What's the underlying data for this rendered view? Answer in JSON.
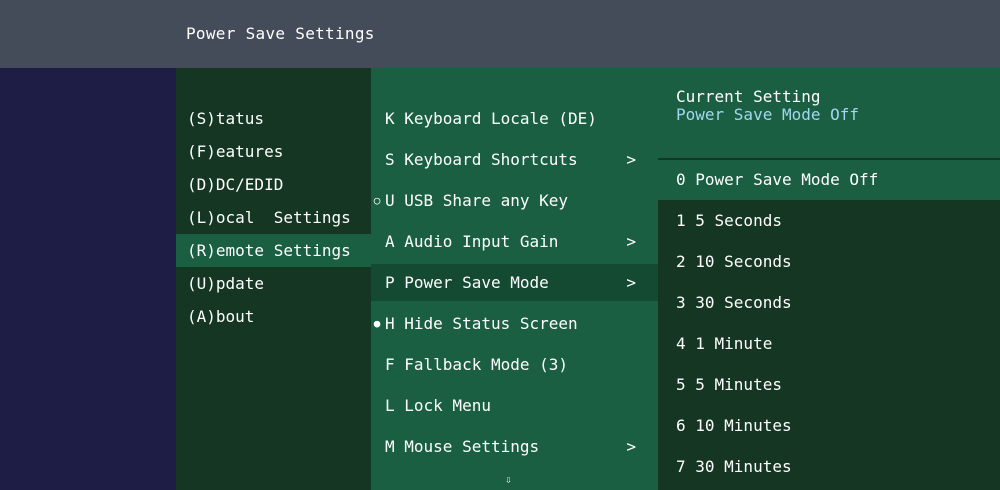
{
  "title": "Power Save Settings",
  "colors": {
    "title_bar": "#444c5a",
    "left_strip": "#1e1d46",
    "dark_green": "#143623",
    "mid_green": "#1a5f42",
    "current_value_text": "#9fd8ee"
  },
  "main_menu": [
    {
      "label": "(S)tatus",
      "selected": false
    },
    {
      "label": "(F)eatures",
      "selected": false
    },
    {
      "label": "(D)DC/EDID",
      "selected": false
    },
    {
      "label": "(L)ocal  Settings",
      "selected": false
    },
    {
      "label": "(R)emote Settings",
      "selected": true
    },
    {
      "label": "(U)pdate",
      "selected": false
    },
    {
      "label": "(A)bout",
      "selected": false
    }
  ],
  "sub_menu": [
    {
      "label": "K Keyboard Locale (DE)",
      "marker": "",
      "arrow": "",
      "selected": false
    },
    {
      "label": "S Keyboard Shortcuts",
      "marker": "",
      "arrow": ">",
      "selected": false
    },
    {
      "label": "U USB Share any Key",
      "marker": "○",
      "arrow": "",
      "selected": false
    },
    {
      "label": "A Audio Input Gain",
      "marker": "",
      "arrow": ">",
      "selected": false
    },
    {
      "label": "P Power Save Mode",
      "marker": "",
      "arrow": ">",
      "selected": true
    },
    {
      "label": "H Hide Status Screen",
      "marker": "●",
      "arrow": "",
      "selected": false
    },
    {
      "label": "F Fallback Mode (3)",
      "marker": "",
      "arrow": "",
      "selected": false
    },
    {
      "label": "L Lock Menu",
      "marker": "",
      "arrow": "",
      "selected": false
    },
    {
      "label": "M Mouse Settings",
      "marker": "",
      "arrow": ">",
      "selected": false
    }
  ],
  "more_indicator": "⇩",
  "current_setting": {
    "label": "Current Setting",
    "value": "Power Save Mode Off"
  },
  "options": [
    {
      "label": "0 Power Save Mode Off",
      "selected": true
    },
    {
      "label": "1 5 Seconds",
      "selected": false
    },
    {
      "label": "2 10 Seconds",
      "selected": false
    },
    {
      "label": "3 30 Seconds",
      "selected": false
    },
    {
      "label": "4 1 Minute",
      "selected": false
    },
    {
      "label": "5 5 Minutes",
      "selected": false
    },
    {
      "label": "6 10 Minutes",
      "selected": false
    },
    {
      "label": "7 30 Minutes",
      "selected": false
    }
  ]
}
